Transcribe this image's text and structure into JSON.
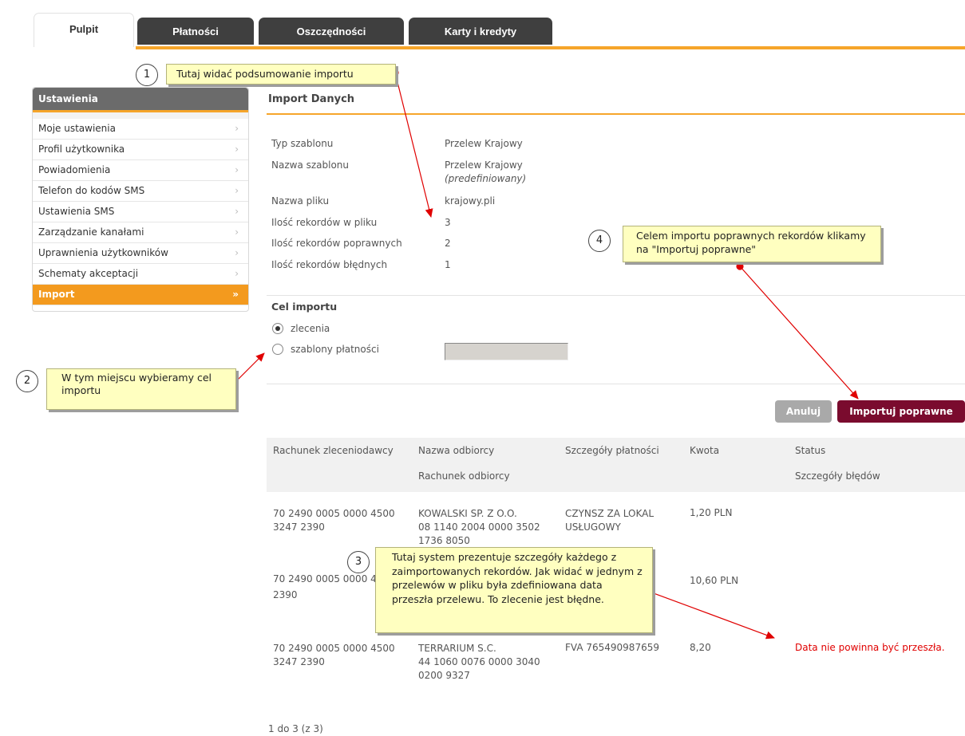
{
  "tabs": [
    {
      "label": "Pulpit",
      "active": true
    },
    {
      "label": "Płatności"
    },
    {
      "label": "Oszczędności"
    },
    {
      "label": "Karty i kredyty"
    }
  ],
  "sidebar": {
    "title": "Ustawienia",
    "items": [
      {
        "label": "Moje ustawienia",
        "chevron": "›"
      },
      {
        "label": "Profil użytkownika",
        "chevron": "›"
      },
      {
        "label": "Powiadomienia",
        "chevron": "›"
      },
      {
        "label": "Telefon do kodów SMS",
        "chevron": "›"
      },
      {
        "label": "Ustawienia SMS",
        "chevron": "›"
      },
      {
        "label": "Zarządzanie kanałami",
        "chevron": "›"
      },
      {
        "label": "Uprawnienia użytkowników",
        "chevron": "›"
      },
      {
        "label": "Schematy akceptacji",
        "chevron": "›"
      },
      {
        "label": "Import",
        "chevron": "»",
        "active": true
      }
    ]
  },
  "main": {
    "title": "Import Danych",
    "summary": [
      {
        "label": "Typ szablonu",
        "value": "Przelew Krajowy"
      },
      {
        "label": "Nazwa szablonu",
        "value": "Przelew Krajowy",
        "note": "(predefiniowany)"
      },
      {
        "label": "Nazwa pliku",
        "value": "krajowy.pli"
      },
      {
        "label": "Ilość rekordów w pliku",
        "value": "3"
      },
      {
        "label": "Ilość rekordów poprawnych",
        "value": "2"
      },
      {
        "label": "Ilość rekordów błędnych",
        "value": "1"
      }
    ],
    "target": {
      "title": "Cel importu",
      "options": [
        {
          "label": "zlecenia",
          "selected": true
        },
        {
          "label": "szablony płatności",
          "selected": false
        }
      ]
    },
    "buttons": {
      "cancel": "Anuluj",
      "import": "Importuj poprawne"
    },
    "table": {
      "headers": {
        "account": "Rachunek zleceniodawcy",
        "recipient": "Nazwa odbiorcy",
        "recipient_account": "Rachunek odbiorcy",
        "details": "Szczegóły płatności",
        "amount": "Kwota",
        "status": "Status",
        "errors": "Szczegóły błędów"
      },
      "rows": [
        {
          "account": "70 2490 0005 0000 4500 3247 2390",
          "recipient": "KOWALSKI SP. Z O.O.",
          "recipient_account": "08 1140 2004 0000 3502 1736 8050",
          "details": "CZYNSZ ZA LOKAL USŁUGOWY",
          "amount": "1,20 PLN",
          "error": ""
        },
        {
          "account": "70 2490 0005 0000 45",
          "recipient": "",
          "recipient_account": "",
          "details": "",
          "amount": "10,60 PLN",
          "error": ""
        },
        {
          "account": "70 2490 0005 0000 4500 3247 2390",
          "recipient": "TERRARIUM S.C.",
          "recipient_account": "44 1060 0076 0000 3040 0200 9327",
          "details": "FVA 765490987659",
          "amount": "8,20",
          "error": "Data nie powinna być przeszła."
        }
      ]
    },
    "pagination": "1 do 3 (z 3)"
  },
  "annotations": [
    {
      "number": "1",
      "text": "Tutaj widać podsumowanie importu"
    },
    {
      "number": "2",
      "text": "W tym miejscu wybieramy cel importu"
    },
    {
      "number": "3",
      "text": "Tutaj system prezentuje szczegóły każdego z zaimportowanych rekordów. Jak widać w jednym z przelewów w pliku była zdefiniowana data przeszła przelewu. To zlecenie jest błędne."
    },
    {
      "number": "4",
      "text": "Celem importu poprawnych rekordów klikamy na \"Importuj poprawne\""
    }
  ],
  "colors": {
    "accent": "#f6a52a",
    "primary_button": "#7a0b2e",
    "error": "#e00000",
    "note_bg": "#ffffc0",
    "arrow": "#e00000"
  }
}
